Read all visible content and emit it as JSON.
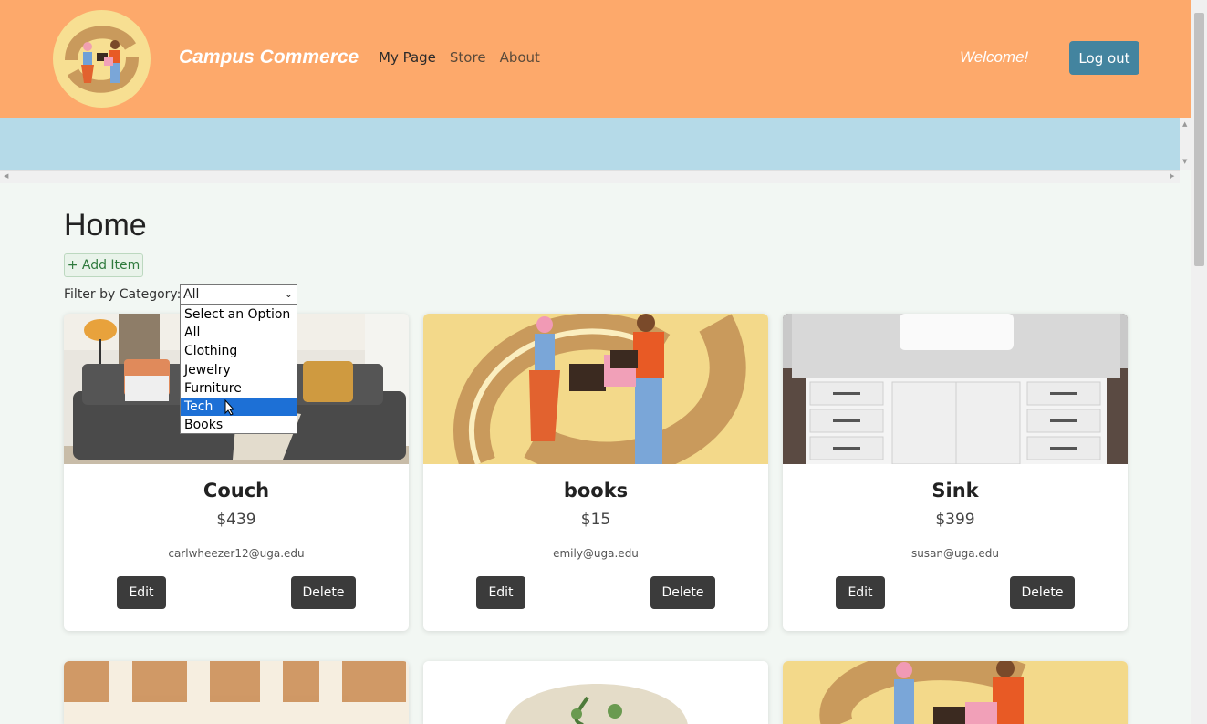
{
  "header": {
    "brand": "Campus Commerce",
    "nav": [
      "My Page",
      "Store",
      "About"
    ],
    "welcome": "Welcome!",
    "logout_label": "Log out"
  },
  "main": {
    "title": "Home",
    "add_item_label": "+ Add Item",
    "filter_label": "Filter by Category:",
    "filter_value": "All",
    "filter_options": [
      "Select an Option",
      "All",
      "Clothing",
      "Jewelry",
      "Furniture",
      "Tech",
      "Books"
    ],
    "highlighted_option": "Tech"
  },
  "items": [
    {
      "title": "Couch",
      "price": "$439",
      "email": "carlwheezer12@uga.edu",
      "edit_label": "Edit",
      "delete_label": "Delete"
    },
    {
      "title": "books",
      "price": "$15",
      "email": "emily@uga.edu",
      "edit_label": "Edit",
      "delete_label": "Delete"
    },
    {
      "title": "Sink",
      "price": "$399",
      "email": "susan@uga.edu",
      "edit_label": "Edit",
      "delete_label": "Delete"
    }
  ],
  "colors": {
    "header_bg": "#fda96b",
    "banner_bg": "#b5dae8",
    "logout_bg": "#43849f",
    "button_dark": "#3b3b3b",
    "highlight": "#1d70d6"
  }
}
